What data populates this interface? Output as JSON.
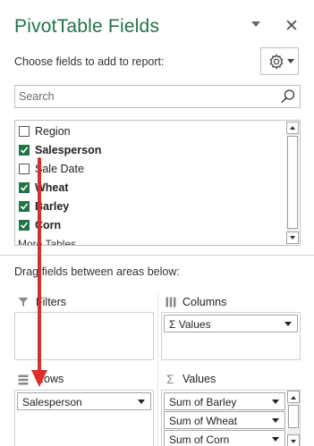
{
  "header": {
    "title": "PivotTable Fields"
  },
  "choose_label": "Choose fields to add to report:",
  "search": {
    "placeholder": "Search"
  },
  "fields": [
    {
      "label": "Region",
      "checked": false,
      "bold": false
    },
    {
      "label": "Salesperson",
      "checked": true,
      "bold": true
    },
    {
      "label": "Sale Date",
      "checked": false,
      "bold": false
    },
    {
      "label": "Wheat",
      "checked": true,
      "bold": true
    },
    {
      "label": "Barley",
      "checked": true,
      "bold": true
    },
    {
      "label": "Corn",
      "checked": true,
      "bold": true
    }
  ],
  "more_tables": "More Tables...",
  "drag_label": "Drag fields between areas below:",
  "areas": {
    "filters": {
      "label": "Filters"
    },
    "columns": {
      "label": "Columns",
      "chips": [
        "Values"
      ]
    },
    "rows": {
      "label": "Rows",
      "chips": [
        "Salesperson"
      ]
    },
    "values": {
      "label": "Values",
      "chips": [
        "Sum of Barley",
        "Sum of Wheat",
        "Sum of Corn"
      ]
    }
  },
  "icons": {
    "sigma": "Σ",
    "close": "✕"
  },
  "colors": {
    "accent": "#217346",
    "annotation": "#e02b2b"
  }
}
